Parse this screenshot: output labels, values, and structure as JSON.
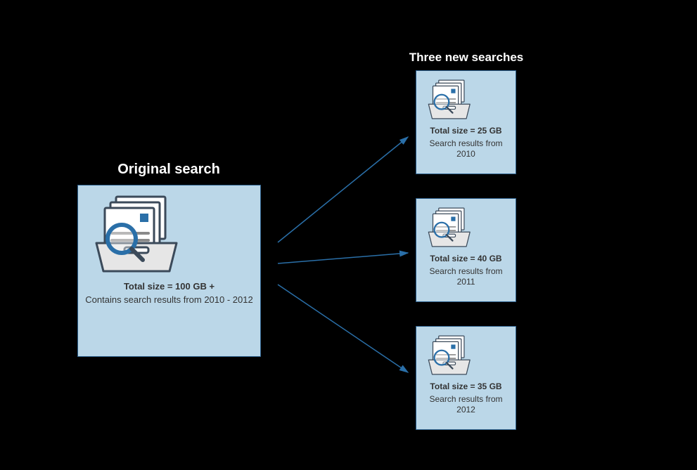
{
  "headers": {
    "original": "Original search",
    "split": "Three new searches"
  },
  "source": {
    "size_label": "Total size = 100 GB +",
    "desc": "Contains search results from 2010 - 2012"
  },
  "targets": [
    {
      "size_label": "Total size = 25 GB",
      "desc": "Search results from 2010"
    },
    {
      "size_label": "Total size = 40 GB",
      "desc": "Search results from 2011"
    },
    {
      "size_label": "Total size = 35 GB",
      "desc": "Search results from 2012"
    }
  ],
  "colors": {
    "card_bg": "#bbd7e8",
    "card_border": "#2a5d8a",
    "accent": "#2a6fa8"
  }
}
